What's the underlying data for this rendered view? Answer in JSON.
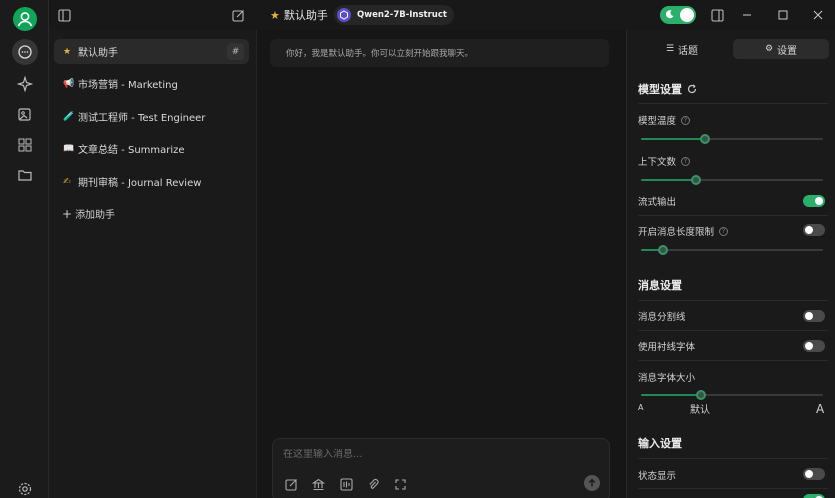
{
  "topbar": {
    "assistant_star": "★",
    "assistant_title": "默认助手",
    "model_name": "Qwen2-7B-Instruct"
  },
  "assistants": {
    "items": [
      {
        "emoji": "★",
        "label": "默认助手",
        "active": true,
        "badge": "#"
      },
      {
        "emoji": "📢",
        "label": "市场营销 - Marketing"
      },
      {
        "emoji": "🧪",
        "label": "测试工程师 - Test Engineer"
      },
      {
        "emoji": "📖",
        "label": "文章总结 - Summarize"
      },
      {
        "emoji": "✍",
        "label": "期刊审稿 - Journal Review"
      }
    ],
    "add_plus": "+",
    "add_label": "添加助手"
  },
  "chat": {
    "welcome": "你好，我是默认助手。你可以立刻开始跟我聊天。",
    "input_placeholder": "在这里输入消息..."
  },
  "settings": {
    "tabs": [
      {
        "label": "话题",
        "glyph": "☰"
      },
      {
        "label": "设置",
        "glyph": "⚙",
        "active": true
      }
    ],
    "model_section": "模型设置",
    "temperature_label": "模型温度",
    "temperature_value": 0.35,
    "context_label": "上下文数",
    "context_value": 0.3,
    "stream_label": "流式输出",
    "stream_on": true,
    "max_length_label": "开启消息长度限制",
    "max_length_on": false,
    "max_length_value": 0.12,
    "message_section": "消息设置",
    "divider_label": "消息分割线",
    "divider_on": false,
    "serif_label": "使用衬线字体",
    "serif_on": false,
    "font_size_label": "消息字体大小",
    "font_size_value": 0.33,
    "font_size_small": "A",
    "font_size_default": "默认",
    "font_size_large": "A",
    "input_section": "输入设置",
    "status_label": "状态显示",
    "status_on": false
  },
  "colors": {
    "accent": "#2ab06a",
    "avatar": "#10a659",
    "star": "#e6b23c"
  }
}
